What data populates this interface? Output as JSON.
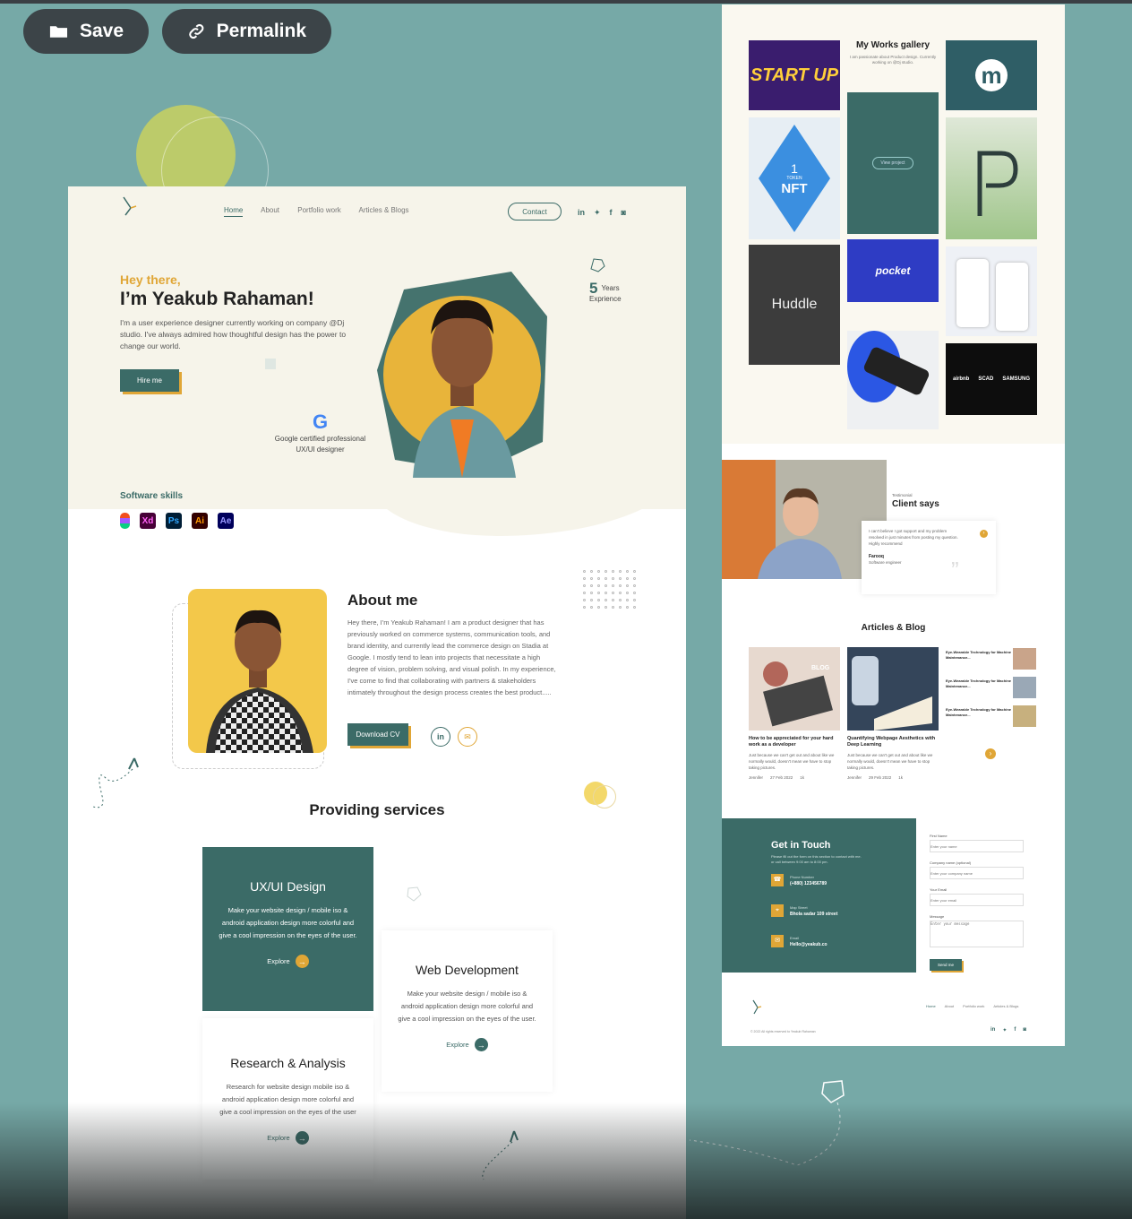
{
  "toolbar": {
    "save": "Save",
    "permalink": "Permalink"
  },
  "colors": {
    "teal": "#3b6b67",
    "accent": "#e0a636",
    "bg": "#76a9a7"
  },
  "site": {
    "nav": [
      "Home",
      "About",
      "Portfolio work",
      "Articles & Blogs"
    ],
    "contact": "Contact",
    "social": [
      "in",
      "t",
      "f",
      "ig"
    ],
    "hero": {
      "hey": "Hey there,",
      "name": "I’m Yeakub Rahaman!",
      "intro": "I'm a user experience designer currently working on company @Dj studio. I've always admired how thoughtful design has the power to change our world.",
      "hire": "Hire me",
      "years_num": "5",
      "years_l1": "Years",
      "years_l2": "Exprience",
      "gcert": "Google certified professional UX/UI designer"
    },
    "skills_title": "Software skills",
    "skills": [
      "Xd",
      "Ps",
      "Ai",
      "Ae"
    ],
    "about": {
      "title": "About me",
      "text": "Hey there, I'm Yeakub Rahaman! I am a product designer that has previously worked on commerce systems, communication tools, and brand identity, and currently lead the commerce design on Stadia at Google. I mostly tend to lean into projects that necessitate a high degree of vision, problem solving, and visual polish. In my experience, I've come to find that collaborating with partners & stakeholders intimately throughout the design process creates the best product.....",
      "download": "Download CV",
      "in": "in"
    },
    "services": {
      "title": "Providing services",
      "cards": [
        {
          "title": "UX/UI Design",
          "text": "Make your website design / mobile iso & android application design more colorful and give a cool impression on the eyes of the user.",
          "explore": "Explore"
        },
        {
          "title": "Web Development",
          "text": "Make your website design / mobile iso & android application design more colorful and give a cool impression on the eyes of the user.",
          "explore": "Explore"
        },
        {
          "title": "Research & Analysis",
          "text": "Research  for  website design mobile iso & android application design more colorful and give a cool impression on the eyes of the user",
          "explore": "Explore"
        }
      ]
    }
  },
  "right": {
    "gallery": {
      "title": "My Works gallery",
      "sub": "I am passionate about Product design. Currently working on @Dj studio.",
      "view": "View project",
      "t_startup": "START UP",
      "t_token": "1",
      "t_token2": "TOKEN",
      "t_nft": "NFT",
      "t_huddle": "Huddle",
      "t_pocket": "pocket",
      "t_airbnb": "airbnb",
      "t_scad": "SCAD",
      "t_samsung": "SAMSUNG",
      "t_m": "m"
    },
    "client": {
      "tag": "Testimonial",
      "title": "Client says",
      "quote": "I can't believe I got support and my problem resolved in just minutes from posting my question. Highly recommend",
      "person": "Farooq",
      "role": "Software engineer"
    },
    "articles": {
      "title": "Articles & Blog",
      "blog_tag": "BLOG",
      "items": [
        {
          "title": "How to be appreciated for your hard work as a developer",
          "text": "Just because we can't get out and about like we normally would, doesn't mean we have to stop taking pictures.",
          "author": "Jennifer",
          "date": "27 Feb 2022",
          "views": "1k"
        },
        {
          "title": "Quantifying Webpage Aesthetics with Deep Learning",
          "text": "Just because we can't get out and about like we normally would, doesn't mean we have to stop taking pictures.",
          "author": "Jennifer",
          "date": "29 Feb 2022",
          "views": "1k"
        }
      ],
      "side": [
        "Eye-Wearable Technology for Machine Maintenance...",
        "Eye-Wearable Technology for Machine Maintenance...",
        "Eye-Wearable Technology for Machine Maintenance..."
      ]
    },
    "contact": {
      "title": "Get in Touch",
      "sub": "Please fill out the form on this section to contact with me. or call between 9:00 am to 8:00 pm.",
      "phone_l": "Phone Number",
      "phone": "(+880) 123456789",
      "addr_l": "Map Street",
      "addr": "Bhola sadar 109 street",
      "email_l": "Email",
      "email": "Hello@yeakub.co",
      "labels": [
        "First Name",
        "Company name (optional)",
        "Your Email",
        "Message"
      ],
      "placeholders": [
        "Enter your name",
        "Enter your company name",
        "Enter your email",
        "Enter your message"
      ],
      "send": "Send me"
    },
    "footer": {
      "nav": [
        "Home",
        "About",
        "Portfolio work",
        "Articles & Blogs"
      ],
      "copy": "© 2022 All rights reserved to Yeakub Rahaman"
    }
  }
}
